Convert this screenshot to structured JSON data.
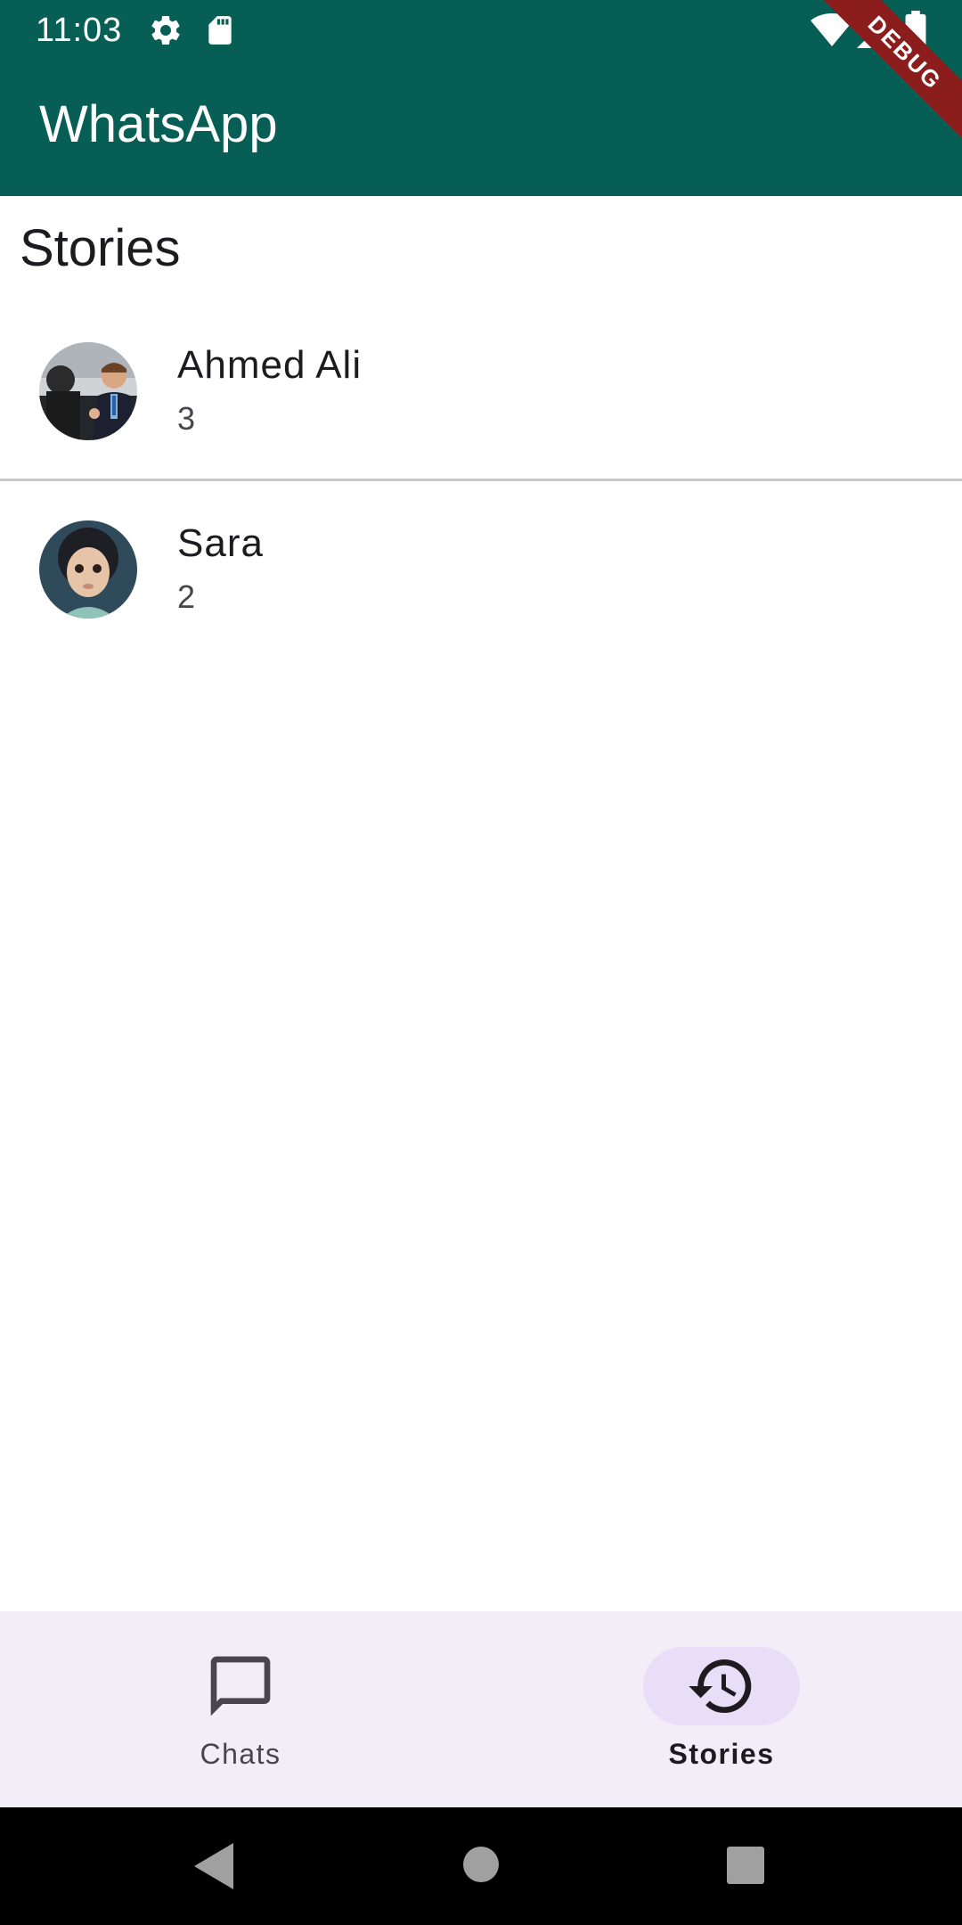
{
  "status_bar": {
    "time": "11:03",
    "left_icons": [
      "gear-icon",
      "sd-card-icon"
    ],
    "right_icons": [
      "wifi-icon",
      "signal-icon",
      "battery-icon"
    ]
  },
  "app_bar": {
    "title": "WhatsApp",
    "debug_banner": "DEBUG",
    "color": "#075e54"
  },
  "section": {
    "title": "Stories"
  },
  "stories": [
    {
      "name": "Ahmed Ali",
      "count": "3"
    },
    {
      "name": "Sara",
      "count": "2"
    }
  ],
  "bottom_nav": {
    "items": [
      {
        "label": "Chats",
        "icon": "chat-bubble-icon",
        "selected": false
      },
      {
        "label": "Stories",
        "icon": "history-icon",
        "selected": true
      }
    ]
  },
  "system_nav": {
    "buttons": [
      "back-icon",
      "home-icon",
      "recents-icon"
    ]
  }
}
